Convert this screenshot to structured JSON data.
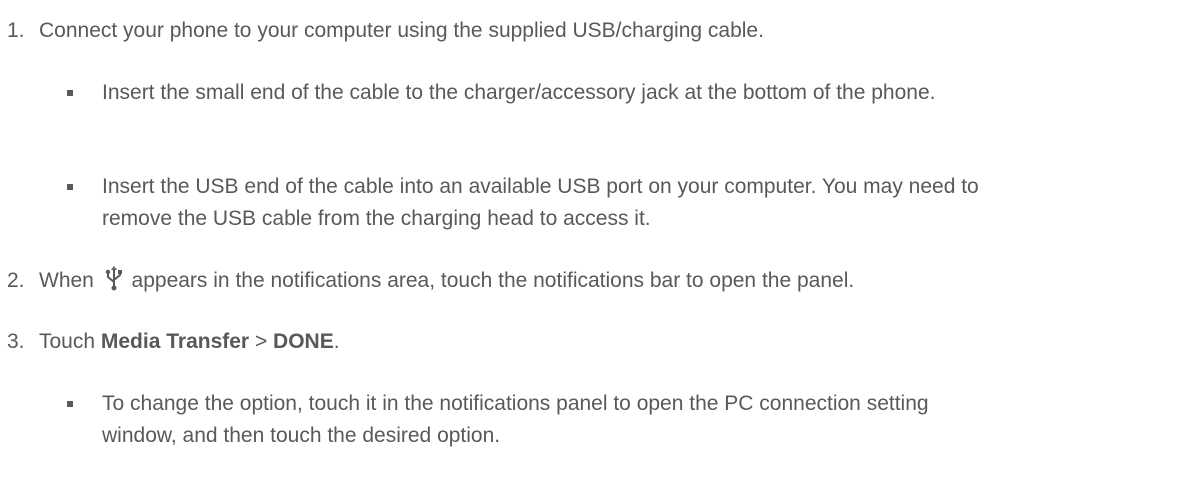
{
  "steps": [
    {
      "number": "1.",
      "text": "Connect your phone to your computer using the supplied USB/charging cable."
    },
    {
      "number": "2.",
      "text_before": "When",
      "icon": "usb-icon",
      "text_after": "appears in the notifications area, touch the notifications bar to open the panel."
    },
    {
      "number": "3.",
      "text_before": "Touch ",
      "bold1": "Media Transfer",
      "separator": " > ",
      "bold2": "DONE",
      "text_after": "."
    }
  ],
  "bullets": [
    "Insert the small end of the cable to the charger/accessory jack at the bottom of the phone.",
    "Insert the USB end of the cable into an available USB port on your computer. You may need to remove the USB cable from the charging head to access it.",
    "To change the option, touch it in the notifications panel to open the PC connection setting window, and then touch the desired option."
  ],
  "colors": {
    "text": "#595959",
    "background": "#ffffff"
  }
}
